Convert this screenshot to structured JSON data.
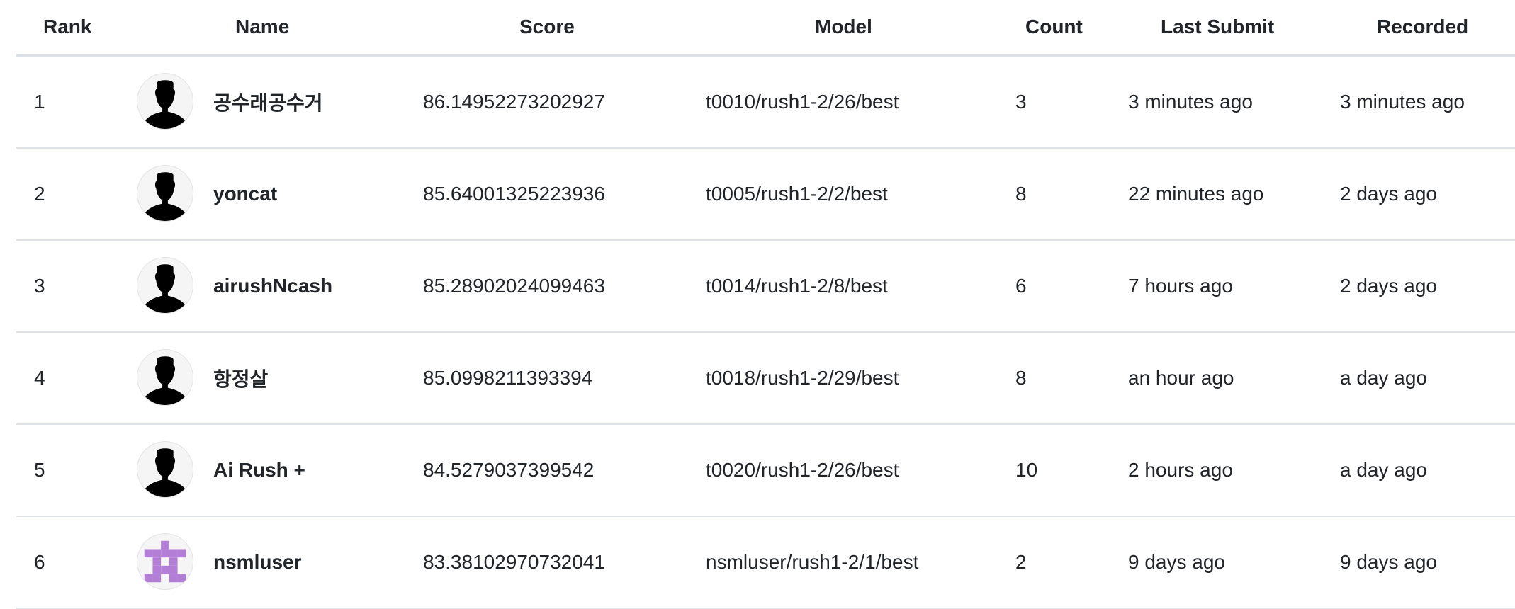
{
  "headers": {
    "rank": "Rank",
    "name": "Name",
    "score": "Score",
    "model": "Model",
    "count": "Count",
    "last_submit": "Last Submit",
    "recorded": "Recorded"
  },
  "rows": [
    {
      "rank": "1",
      "name": "공수래공수거",
      "avatar": "silhouette-avatar",
      "score": "86.14952273202927",
      "model": "t0010/rush1-2/26/best",
      "count": "3",
      "last_submit": "3 minutes ago",
      "recorded": "3 minutes ago"
    },
    {
      "rank": "2",
      "name": "yoncat",
      "avatar": "silhouette-avatar",
      "score": "85.64001325223936",
      "model": "t0005/rush1-2/2/best",
      "count": "8",
      "last_submit": "22 minutes ago",
      "recorded": "2 days ago"
    },
    {
      "rank": "3",
      "name": "airushNcash",
      "avatar": "silhouette-avatar",
      "score": "85.28902024099463",
      "model": "t0014/rush1-2/8/best",
      "count": "6",
      "last_submit": "7 hours ago",
      "recorded": "2 days ago"
    },
    {
      "rank": "4",
      "name": "항정살",
      "avatar": "silhouette-avatar",
      "score": "85.0998211393394",
      "model": "t0018/rush1-2/29/best",
      "count": "8",
      "last_submit": "an hour ago",
      "recorded": "a day ago"
    },
    {
      "rank": "5",
      "name": "Ai Rush +",
      "avatar": "silhouette-avatar",
      "score": "84.5279037399542",
      "model": "t0020/rush1-2/26/best",
      "count": "10",
      "last_submit": "2 hours ago",
      "recorded": "a day ago"
    },
    {
      "rank": "6",
      "name": "nsmluser",
      "avatar": "identicon-avatar",
      "score": "83.38102970732041",
      "model": "nsmluser/rush1-2/1/best",
      "count": "2",
      "last_submit": "9 days ago",
      "recorded": "9 days ago"
    }
  ],
  "colors": {
    "identicon": "#b37fd6",
    "silhouette": "#000000",
    "border": "#dee2e6"
  }
}
